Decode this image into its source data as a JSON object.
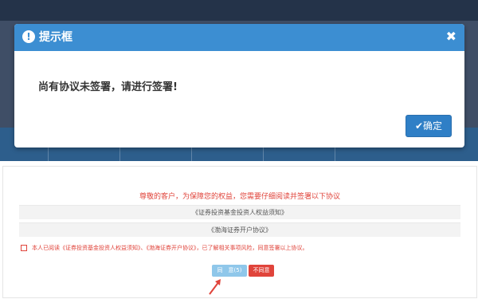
{
  "dialog": {
    "title": "提示框",
    "close_symbol": "✖",
    "message": "尚有协议未签署，请进行签署!",
    "confirm_label": "✔确定"
  },
  "agreement": {
    "notice": "尊敬的客户，为保障您的权益，您需要仔细阅读并签署以下协议",
    "documents": [
      "《证券投资基金投资人权益须知》",
      "《渤海证券开户协议》"
    ],
    "consent_text": "本人已阅读《证券投资基金投资人权益须知》、《渤海证券开户协议》，已了解相关事项风险，同意签署以上协议。",
    "agree_label": "同　意(5)",
    "disagree_label": "不同意"
  },
  "colors": {
    "header_blue": "#3c8ed2",
    "confirm_blue": "#2f7fc6",
    "warning_red": "#e0443b",
    "agree_light_blue": "#8fc7ea"
  },
  "icons": {
    "dialog_icon": "exclamation-circle-icon",
    "close_icon": "close-icon",
    "confirm_icon": "checkmark-icon",
    "arrow": "pointer-arrow-icon"
  }
}
